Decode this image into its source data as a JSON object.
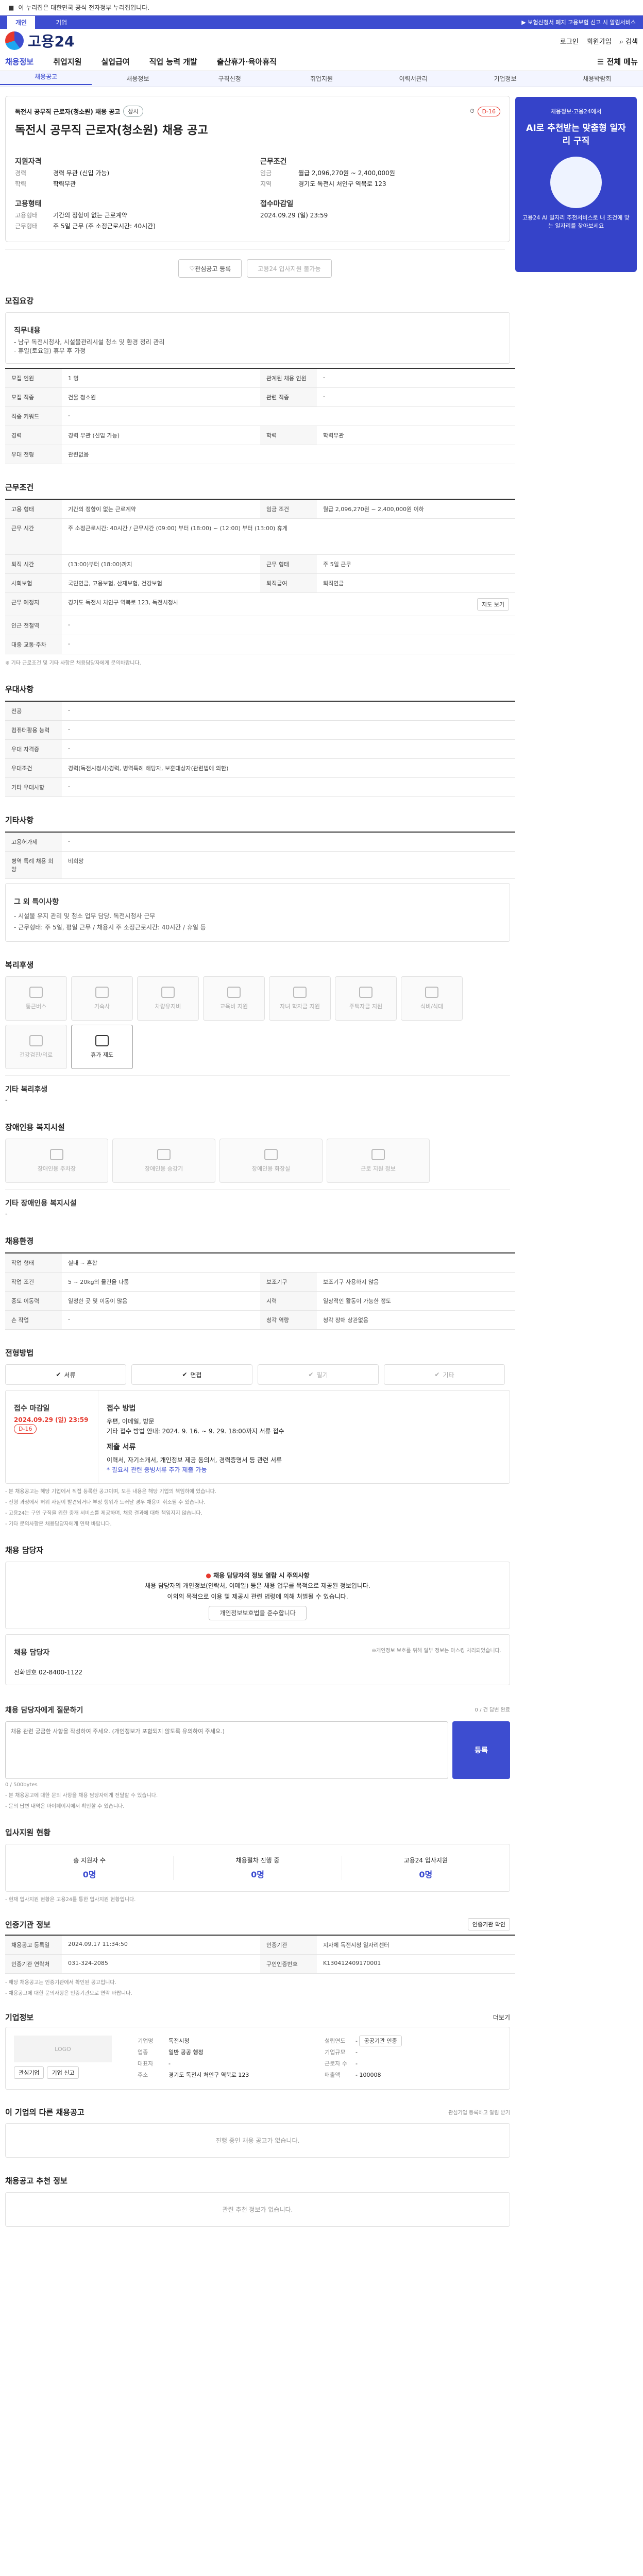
{
  "notice": {
    "text": "이 누리집은 대한민국 공식 전자정부 누리집입니다."
  },
  "top_tabs": {
    "items": [
      "개인",
      "기업"
    ],
    "active": "개인"
  },
  "util": {
    "links": [
      "로그인",
      "회원가입",
      "고객센터",
      "ENG"
    ],
    "alert": "▶ 보험신청서 폐지 고용보험 신고 시 알림서비스"
  },
  "logo": {
    "text": "고용24"
  },
  "right_util": {
    "items": [
      "로그인",
      "회원가입",
      "검색"
    ]
  },
  "gnb": {
    "items": [
      "채용정보",
      "취업지원",
      "실업급여",
      "직업 능력 개발",
      "출산휴가·육아휴직"
    ],
    "all_menu": "전체 메뉴"
  },
  "lnb": {
    "items": [
      "채용공고",
      "채용정보",
      "구직신청",
      "취업지원",
      "이력서관리",
      "기업정보",
      "채용박람회"
    ],
    "active": "채용공고"
  },
  "job": {
    "category": "채용",
    "badge1": "상시",
    "badge2": "D-16",
    "company": "독전시 공무직 근로자(청소원) 채용 공고",
    "title": "독전시 공무직 근로자(청소원) 채용 공고",
    "info_left_title": "지원자격",
    "info_left": [
      {
        "k": "경력",
        "v": "경력 무관 (신입 가능)"
      },
      {
        "k": "학력",
        "v": "학력무관"
      }
    ],
    "info_right_title": "근무조건",
    "info_right": [
      {
        "k": "임금",
        "v": "월급 2,096,270원 ~ 2,400,000원"
      },
      {
        "k": "지역",
        "v": "경기도 독전시 처인구 역북로 123"
      }
    ],
    "employ_title": "고용형태",
    "employ": [
      {
        "k": "고용형태",
        "v": "기간의 정함이 없는 근로계약"
      },
      {
        "k": "근무형태",
        "v": "주 5일 근무 (주 소정근로시간: 40시간)"
      }
    ],
    "period_title": "접수마감일",
    "period": "2024.09.29 (일) 23:59",
    "save_button": "관심공고 등록",
    "share_button": "고용24 입사지원 불가능"
  },
  "recruit": {
    "section_title": "모집요강",
    "desc_title": "직무내용",
    "desc_lines": [
      "- 남구 독전시청사, 시설물관리시설 청소 및 환경 정리 관리",
      "- 휴일(토요일) 휴무 후 가정"
    ],
    "rows": [
      {
        "th1": "모집 인원",
        "td1": "1 명",
        "th2": "관계된 채용 인원",
        "td2": "-"
      },
      {
        "th1": "모집 직종",
        "td1": "건물 청소원",
        "th2": "관련 직종",
        "td2": "-"
      },
      {
        "th1": "직종 키워드",
        "td1": "-",
        "th2": "",
        "td2": ""
      },
      {
        "th1": "경력",
        "td1": "경력 무관 (신입 가능)",
        "th2": "학력",
        "td2": "학력무관"
      },
      {
        "th1": "우대 전형",
        "td1": "관련없음",
        "th2": "",
        "td2": ""
      }
    ]
  },
  "work": {
    "section_title": "근무조건",
    "rows": [
      {
        "th1": "고용 형태",
        "td1": "기간의 정함이 없는 근로계약",
        "th2": "임금 조건",
        "td2": "월급 2,096,270원 ~ 2,400,000원 이하"
      },
      {
        "th1": "근무 시간",
        "td1": "주 소정근로시간: 40시간 / 근무시간 (09:00) 부터 (18:00) ~ (12:00) 부터 (13:00) 휴게",
        "th2": "",
        "td2": ""
      },
      {
        "th1": "퇴직 시간",
        "td1": "(13:00)부터 (18:00)까지",
        "th2": "근무 형태",
        "td2": "주 5일 근무"
      },
      {
        "th1": "사회보험",
        "td1": "국민연금, 고용보험, 산재보험, 건강보험",
        "th2": "퇴직급여",
        "td2": "퇴직연금"
      },
      {
        "th1": "근무 예정지",
        "td1": "경기도 독전시 처인구 역북로 123, 독전시청사",
        "th2": "",
        "td2": ""
      },
      {
        "th1": "인근 전철역",
        "td1": "-",
        "th2": "",
        "td2": ""
      },
      {
        "th1": "대중 교통·주차",
        "td1": "-",
        "th2": "",
        "td2": ""
      }
    ],
    "note": "※ 기타 근로조건 및 기타 사항은 채용담당자에게 문의바랍니다.",
    "map_button": "지도 보기"
  },
  "pref": {
    "section_title": "우대사항",
    "rows": [
      {
        "th": "전공",
        "td": "-"
      },
      {
        "th": "컴퓨터활용 능력",
        "td": "-"
      },
      {
        "th": "우대 자격증",
        "td": "-"
      },
      {
        "th": "우대조건",
        "td": "경력(독전시청사)경력, 병역특례 해당자, 보훈대상자(관련법에 의한)"
      },
      {
        "th": "기타 우대사항",
        "td": "-"
      }
    ]
  },
  "other": {
    "section_title": "기타사항",
    "rows": [
      {
        "th": "고용허가제",
        "td": "-"
      },
      {
        "th": "병역 특례 채용 희망",
        "td": "비희망"
      }
    ],
    "box_title": "그 외 특이사항",
    "box_lines": [
      "- 시설물 유지 관리 및 청소 업무 담당. 독전시청사 근무",
      "- 근무형태: 주 5일, 평일 근무 / 채용시 주 소정근로시간: 40시간 / 휴일 등"
    ]
  },
  "welfare": {
    "section_title": "복리후생",
    "items": [
      {
        "name": "통근버스",
        "on": false
      },
      {
        "name": "기숙사",
        "on": false
      },
      {
        "name": "차량유지비",
        "on": false
      },
      {
        "name": "교육비 지원",
        "on": false
      },
      {
        "name": "자녀 학자금 지원",
        "on": false
      },
      {
        "name": "주택자금 지원",
        "on": false
      },
      {
        "name": "식비/식대",
        "on": false
      },
      {
        "name": "건강검진/의료",
        "on": false
      },
      {
        "name": "휴가 제도",
        "on": true
      }
    ],
    "other_title": "기타 복리후생",
    "other_value": "-"
  },
  "disabled": {
    "section_title": "장애인용 복지시설",
    "items": [
      {
        "name": "장애인용 주차장",
        "on": false
      },
      {
        "name": "장애인용 승강기",
        "on": false
      },
      {
        "name": "장애인용 화장실",
        "on": false
      },
      {
        "name": "근로 지원 정보",
        "on": false
      }
    ],
    "other_title": "기타 장애인용 복지시설",
    "other_value": "-"
  },
  "disabled_cond": {
    "section_title": "채용환경",
    "rows": [
      {
        "th1": "작업 형태",
        "td1": "실내 ~ 혼합",
        "th2": "",
        "td2": ""
      },
      {
        "th1": "작업 조건",
        "td1": "5 ~ 20kg의 물건을 다룸",
        "th2": "보조기구",
        "td2": "보조기구 사용하지 않음"
      },
      {
        "th1": "중도 이동력",
        "td1": "일정한 곳 및 이동이 많음",
        "th2": "시력",
        "td2": "일상적인 활동이 가능한 정도"
      },
      {
        "th1": "손 작업",
        "td1": "-",
        "th2": "청각 역량",
        "td2": "청각 장애 상관없음"
      }
    ]
  },
  "process": {
    "section_title": "전형방법",
    "steps": [
      {
        "name": "서류",
        "on": true
      },
      {
        "name": "면접",
        "on": true
      },
      {
        "name": "필기",
        "on": false
      },
      {
        "name": "기타",
        "on": false
      }
    ],
    "deadline_label": "접수 마감일",
    "deadline_value": "2024.09.29 (일) 23:59",
    "dday": "D-16",
    "method_label": "접수 방법",
    "method_lines": [
      "우편, 이메일, 방문",
      "기타 접수 방법 안내: 2024. 9. 16. ~ 9. 29. 18:00까지 서류 접수"
    ],
    "doc_label": "제출 서류",
    "doc_lines": [
      "이력서, 자기소개서, 개인정보 제공 동의서, 경력증명서 등 관련 서류",
      "* 필요시 관련 증빙서류 추가 제출 가능"
    ],
    "notes": [
      "- 본 채용공고는 해당 기업에서 직접 등록한 공고이며, 모든 내용은 해당 기업의 책임하에 있습니다.",
      "- 전형 과정에서 허위 사실이 발견되거나 부정 행위가 드러날 경우 채용이 취소될 수 있습니다.",
      "- 고용24는 구인 구직을 위한 중개 서비스를 제공하며, 채용 결과에 대해 책임지지 않습니다.",
      "- 기타 문의사항은 채용담당자에게 연락 바랍니다."
    ]
  },
  "manager": {
    "section_title": "채용 담당자",
    "warn_title": "채용 담당자의 정보 열람 시 주의사항",
    "warn_lines": [
      "채용 담당자의 개인정보(연락처, 이메일) 등은 채용 업무를 목적으로 제공된 정보입니다.",
      "이외의 목적으로 이용 및 제공시 관련 법령에 의해 처벌될 수 있습니다."
    ],
    "warn_button": "개인정보보호법을 준수합니다",
    "name": "채용 담당자",
    "phone_label": "전화번호",
    "phone": "02-8400-1122",
    "right_note": "※개인정보 보호를 위해 일부 정보는 마스킹 처리되었습니다."
  },
  "inquiry": {
    "title": "채용 담당자에게 질문하기",
    "placeholder": "채용 관련 궁금한 사항을 작성하여 주세요. (개인정보가 포함되지 않도록 유의하여 주세요.)",
    "counter": "0 / 500bytes",
    "send": "등록",
    "notes": [
      "- 본 채용공고에 대한 문의 사항을 채용 담당자에게 전달할 수 있습니다.",
      "- 문의 답변 내역은 마이페이지에서 확인할 수 있습니다."
    ],
    "right_note": "0 / 건 답변 완료"
  },
  "status": {
    "section_title": "입사지원 현황",
    "items": [
      {
        "label": "총 지원자 수",
        "value": "0명"
      },
      {
        "label": "채용절차 진행 중",
        "value": "0명"
      },
      {
        "label": "고용24 입사지원",
        "value": "0명"
      }
    ],
    "note": "- 현재 입사지원 현황은 고용24를 통한 입사지원 현황입니다."
  },
  "org": {
    "section_title": "인증기관 정보",
    "button": "인증기관 확인",
    "rows": [
      {
        "th1": "채용공고 등록일",
        "td1": "2024.09.17 11:34:50",
        "th2": "인증기관",
        "td2": "지자체 독전시청 일자리센터"
      },
      {
        "th1": "인증기관 연락처",
        "td1": "031-324-2085",
        "th2": "구인인증번호",
        "td2": "K130412409170001"
      }
    ],
    "notes": [
      "- 해당 채용공고는 인증기관에서 확인된 공고입니다.",
      "- 채용공고에 대한 문의사항은 인증기관으로 연락 바랍니다."
    ]
  },
  "company": {
    "section_title": "기업정보",
    "more": "더보기",
    "logo_alt": "LOGO",
    "follow": "관심기업",
    "report": "기업 신고",
    "left_rows": [
      {
        "k": "기업명",
        "v": "독전시청"
      },
      {
        "k": "업종",
        "v": "일반 공공 행정"
      },
      {
        "k": "대표자",
        "v": "-"
      },
      {
        "k": "주소",
        "v": "경기도 독전시 처인구 역북로 123"
      }
    ],
    "right_rows": [
      {
        "k": "설립연도",
        "v": "-"
      },
      {
        "k": "기업규모",
        "v": "-"
      },
      {
        "k": "근로자 수",
        "v": "-"
      },
      {
        "k": "매출액",
        "v": "-"
      }
    ],
    "badge": "공공기관 인증",
    "code": "100008"
  },
  "other_jobs": {
    "section_title": "이 기업의 다른 채용공고",
    "right": "관심기업 등록하고 알림 받기",
    "empty": "진행 중인 채용 공고가 없습니다."
  },
  "similar": {
    "section_title": "채용공고 추천 정보",
    "empty": "관련 추천 정보가 없습니다."
  },
  "ad": {
    "line1": "채용정보·고용24에서",
    "big": "AI로 추천받는 맞춤형 일자리 구직",
    "line2": "고용24 AI 일자리 추천서비스로 내 조건에 맞는 일자리를 찾아보세요"
  }
}
